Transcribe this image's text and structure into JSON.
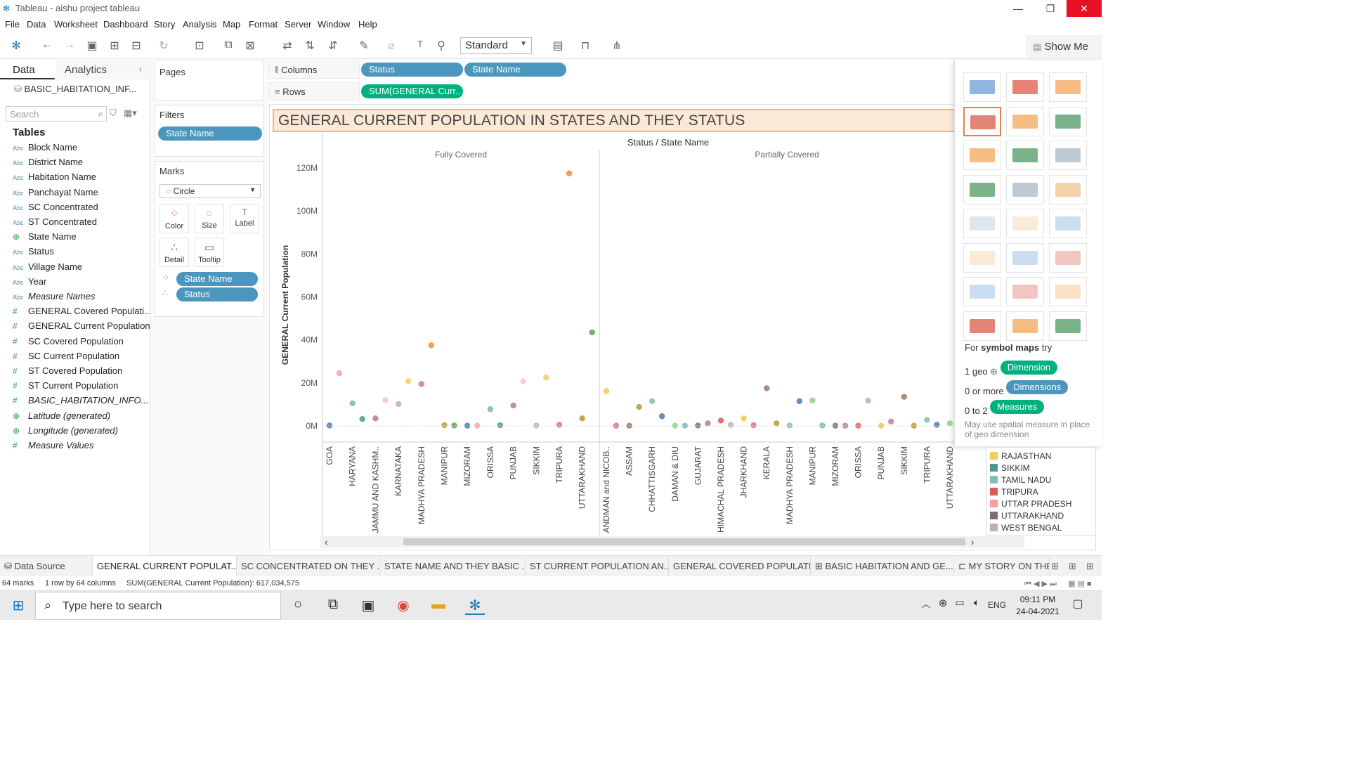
{
  "window": {
    "title": "Tableau - aishu project tableau",
    "minimize": "—",
    "restore": "❐",
    "close": "✕"
  },
  "menu": [
    "File",
    "Data",
    "Worksheet",
    "Dashboard",
    "Story",
    "Analysis",
    "Map",
    "Format",
    "Server",
    "Window",
    "Help"
  ],
  "toolbar": {
    "fit_mode": "Standard",
    "show_me": "Show Me"
  },
  "left_pane": {
    "tabs": {
      "data": "Data",
      "analytics": "Analytics"
    },
    "data_source": "BASIC_HABITATION_INF...",
    "search_placeholder": "Search",
    "tables_heading": "Tables",
    "fields": [
      {
        "type": "Abc",
        "name": "Block Name",
        "italic": false
      },
      {
        "type": "Abc",
        "name": "District Name",
        "italic": false
      },
      {
        "type": "Abc",
        "name": "Habitation Name",
        "italic": false
      },
      {
        "type": "Abc",
        "name": "Panchayat Name",
        "italic": false
      },
      {
        "type": "Abc",
        "name": "SC Concentrated",
        "italic": false
      },
      {
        "type": "Abc",
        "name": "ST Concentrated",
        "italic": false
      },
      {
        "type": "⊕",
        "name": "State Name",
        "italic": false
      },
      {
        "type": "Abc",
        "name": "Status",
        "italic": false
      },
      {
        "type": "Abc",
        "name": "Village Name",
        "italic": false
      },
      {
        "type": "Abc",
        "name": "Year",
        "italic": false
      },
      {
        "type": "Abc",
        "name": "Measure Names",
        "italic": true
      },
      {
        "type": "#",
        "name": "GENERAL Covered Populati...",
        "italic": false
      },
      {
        "type": "#",
        "name": "GENERAL Current Population",
        "italic": false
      },
      {
        "type": "#",
        "name": "SC Covered Population",
        "italic": false
      },
      {
        "type": "#",
        "name": "SC Current Population",
        "italic": false
      },
      {
        "type": "#",
        "name": "ST Covered Population",
        "italic": false
      },
      {
        "type": "#",
        "name": "ST Current Population",
        "italic": false
      },
      {
        "type": "#",
        "name": "BASIC_HABITATION_INFO...",
        "italic": true
      },
      {
        "type": "⊕",
        "name": "Latitude (generated)",
        "italic": true
      },
      {
        "type": "⊕",
        "name": "Longitude (generated)",
        "italic": true
      },
      {
        "type": "#",
        "name": "Measure Values",
        "italic": true
      }
    ]
  },
  "cards": {
    "pages": "Pages",
    "filters": "Filters",
    "filter_pill": "State Name",
    "marks": "Marks",
    "mark_type": "Circle",
    "mark_buttons": [
      "Color",
      "Size",
      "Label",
      "Detail",
      "Tooltip"
    ],
    "mark_pills": [
      "State Name",
      "Status"
    ]
  },
  "shelves": {
    "columns_label": "Columns",
    "rows_label": "Rows",
    "columns": [
      "Status",
      "State Name"
    ],
    "rows": [
      "SUM(GENERAL Curr.."
    ]
  },
  "chart_title": "GENERAL CURRENT POPULATION IN STATES AND THEY STATUS",
  "chart_data": {
    "type": "scatter",
    "header": "Status / State Name",
    "ylabel": "GENERAL Current Population",
    "yticks": [
      "0M",
      "20M",
      "40M",
      "60M",
      "80M",
      "100M",
      "120M"
    ],
    "ylim": [
      0,
      120000000
    ],
    "groups": [
      {
        "name": "Fully Covered",
        "categories": [
          "GOA",
          "HARYANA",
          "JAMMU AND KASHM..",
          "KARNATAKA",
          "MADHYA PRADESH",
          "MANIPUR",
          "MIZORAM",
          "ORISSA",
          "PUNJAB",
          "SIKKIM",
          "TRIPURA",
          "UTTARAKHAND"
        ],
        "series": [
          {
            "category": "GOA",
            "values": [
              0.2,
              24.5
            ]
          },
          {
            "category": "HARYANA",
            "values": [
              10.5,
              3.2
            ]
          },
          {
            "category": "JAMMU AND KASHM..",
            "values": [
              3.5,
              12.0
            ]
          },
          {
            "category": "KARNATAKA",
            "values": [
              10.2,
              20.8
            ]
          },
          {
            "category": "MADHYA PRADESH",
            "values": [
              19.5,
              37.5
            ]
          },
          {
            "category": "MANIPUR",
            "values": [
              0.3,
              0.2
            ]
          },
          {
            "category": "MIZORAM",
            "values": [
              0.1,
              0.1
            ]
          },
          {
            "category": "ORISSA",
            "values": [
              7.8,
              0.3
            ]
          },
          {
            "category": "PUNJAB",
            "values": [
              9.5,
              20.8
            ]
          },
          {
            "category": "SIKKIM",
            "values": [
              0.2,
              22.5
            ]
          },
          {
            "category": "TRIPURA",
            "values": [
              0.5,
              117.5
            ]
          },
          {
            "category": "UTTARAKHAND",
            "values": [
              3.5,
              43.5
            ]
          }
        ]
      },
      {
        "name": "Partially Covered",
        "categories": [
          "ANDMAN and NICOB..",
          "ASSAM",
          "CHHATTISGARH",
          "DAMAN & DIU",
          "GUJARAT",
          "HIMACHAL PRADESH",
          "JHARKHAND",
          "KERALA",
          "MADHYA PRADESH",
          "MANIPUR",
          "MIZORAM",
          "ORISSA",
          "PUNJAB",
          "SIKKIM",
          "TRIPURA",
          "UTTARAKHAND"
        ],
        "series": [
          {
            "category": "ANDMAN and NICOB..",
            "values": [
              16.2,
              0.1
            ]
          },
          {
            "category": "ASSAM",
            "values": [
              0.1,
              8.8
            ]
          },
          {
            "category": "CHHATTISGARH",
            "values": [
              11.5,
              4.5
            ]
          },
          {
            "category": "DAMAN & DIU",
            "values": [
              0.1,
              0.1
            ]
          },
          {
            "category": "GUJARAT",
            "values": [
              0.2,
              1.2
            ]
          },
          {
            "category": "HIMACHAL PRADESH",
            "values": [
              2.5,
              0.5
            ]
          },
          {
            "category": "JHARKHAND",
            "values": [
              3.5,
              0.3
            ]
          },
          {
            "category": "KERALA",
            "values": [
              17.5,
              1.2
            ]
          },
          {
            "category": "MADHYA PRADESH",
            "values": [
              0.2,
              11.5
            ]
          },
          {
            "category": "MANIPUR",
            "values": [
              11.8,
              0.2
            ]
          },
          {
            "category": "MIZORAM",
            "values": [
              0.1,
              0.1
            ]
          },
          {
            "category": "ORISSA",
            "values": [
              0.1,
              11.8
            ]
          },
          {
            "category": "PUNJAB",
            "values": [
              0.1,
              2.0
            ]
          },
          {
            "category": "SIKKIM",
            "values": [
              13.5,
              0.1
            ]
          },
          {
            "category": "TRIPURA",
            "values": [
              2.8,
              0.5
            ]
          },
          {
            "category": "UTTARAKHAND",
            "values": [
              1.2,
              2.5
            ]
          }
        ]
      }
    ],
    "unit": "M"
  },
  "show_me": {
    "hint_prefix": "For",
    "hint_bold": "symbol maps",
    "hint_suffix": "try",
    "req1_label": "1 geo",
    "req1_pill": "Dimension",
    "req2_label": "0 or more",
    "req2_pill": "Dimensions",
    "req3_label": "0 to 2",
    "req3_pill": "Measures",
    "note": "May use spatial measure in place of geo dimension"
  },
  "legend": [
    {
      "label": "RAJASTHAN",
      "color": "#f2cf5b"
    },
    {
      "label": "SIKKIM",
      "color": "#499894"
    },
    {
      "label": "TAMIL NADU",
      "color": "#86bcb6"
    },
    {
      "label": "TRIPURA",
      "color": "#e15759"
    },
    {
      "label": "UTTAR PRADESH",
      "color": "#ff9d9a"
    },
    {
      "label": "UTTARAKHAND",
      "color": "#79706e"
    },
    {
      "label": "WEST BENGAL",
      "color": "#bab0ac"
    }
  ],
  "sheet_tabs": [
    {
      "label": "Data Source",
      "active": false
    },
    {
      "label": "GENERAL CURRENT POPULAT...",
      "active": true
    },
    {
      "label": "SC CONCENTRATED ON THEY ...",
      "active": false
    },
    {
      "label": "STATE NAME AND THEY BASIC ...",
      "active": false
    },
    {
      "label": "ST CURRENT POPULATION AN...",
      "active": false
    },
    {
      "label": "GENERAL COVERED POPULATI...",
      "active": false
    },
    {
      "label": "BASIC HABITATION AND GE...",
      "active": false
    },
    {
      "label": "MY STORY ON THE",
      "active": false
    }
  ],
  "status": {
    "marks": "64 marks",
    "dims": "1 row by 64 columns",
    "sum": "SUM(GENERAL Current Population): 617,034,575"
  },
  "taskbar": {
    "search_placeholder": "Type here to search",
    "lang": "ENG",
    "time": "09:11 PM",
    "date": "24-04-2021"
  }
}
